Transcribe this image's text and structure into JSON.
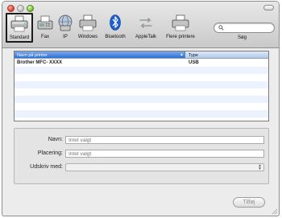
{
  "toolbar": {
    "items": [
      {
        "label": "Standard",
        "icon": "printer-default-icon",
        "selected": true
      },
      {
        "label": "Fax",
        "icon": "fax-icon",
        "selected": false
      },
      {
        "label": "IP",
        "icon": "ip-globe-icon",
        "selected": false
      },
      {
        "label": "Windows",
        "icon": "windows-printer-icon",
        "selected": false
      },
      {
        "label": "Bluetooth",
        "icon": "bluetooth-icon",
        "selected": false
      },
      {
        "label": "AppleTalk",
        "icon": "appletalk-icon",
        "selected": false
      },
      {
        "label": "Flere printere",
        "icon": "more-printers-icon",
        "selected": false
      }
    ],
    "search": {
      "label": "Søg",
      "value": "",
      "placeholder": ""
    }
  },
  "printer_list": {
    "columns": {
      "name": "Navn på printer",
      "type": "Type"
    },
    "sort_indicator": "▲",
    "rows": [
      {
        "name": "Brother MFC- XXXX",
        "type": "USB"
      }
    ]
  },
  "details": {
    "name_label": "Navn:",
    "name_placeholder": "Intet valgt",
    "location_label": "Placering:",
    "location_placeholder": "Intet valgt",
    "print_with_label": "Udskriv med:",
    "print_with_value": ""
  },
  "add_button": {
    "label": "Tilføj"
  },
  "colors": {
    "accent": "#2c6fd6",
    "row_alt": "#edf3fe",
    "bluetooth": "#1e5fd1"
  }
}
